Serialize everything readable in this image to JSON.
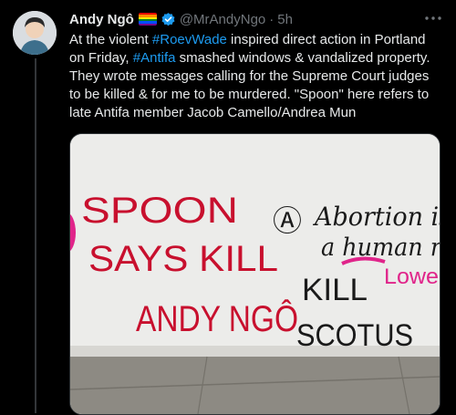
{
  "tweet": {
    "author_name": "Andy Ngô",
    "handle": "@MrAndyNgo",
    "separator": "·",
    "time": "5h",
    "more_icon": "more-horizontal-icon",
    "text": {
      "p1": "At the violent ",
      "tag1": "#RoevWade",
      "p2": " inspired direct action in Portland on Friday, ",
      "tag2": "#Antifa",
      "p3": " smashed windows & vandalized property. They wrote messages calling for the Supreme Court judges to be killed & for me to be murdered. \"Spoon\" here refers to late Antifa member Jacob Camello/Andrea Mun"
    },
    "colors": {
      "hashtag": "#1d9bf0",
      "verified": "#1d9bf0",
      "graffiti_red": "#c8102e"
    }
  },
  "image": {
    "graffiti_red": {
      "line1": "SPOON",
      "line2": "SAYS KILL",
      "line3": "ANDY NGÔ"
    },
    "graffiti_black": {
      "line1": "Abortion is",
      "line2": "a human ri",
      "line3": "KILL",
      "line4": "SCOTUS",
      "anarchy": "Ⓐ"
    },
    "graffiti_pink": {
      "line1": "Lowe"
    }
  }
}
